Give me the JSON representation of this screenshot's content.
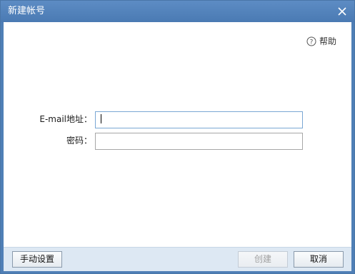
{
  "window": {
    "title": "新建帐号"
  },
  "help": {
    "label": "帮助"
  },
  "form": {
    "email_label": "E-mail地址：",
    "email_value": "",
    "password_label": "密码：",
    "password_value": ""
  },
  "footer": {
    "manual_settings_label": "手动设置",
    "create_label": "创建",
    "cancel_label": "取消"
  },
  "colors": {
    "titlebar": "#5a88c0",
    "footer": "#dde8f3",
    "focus_border": "#7aa7d4"
  }
}
